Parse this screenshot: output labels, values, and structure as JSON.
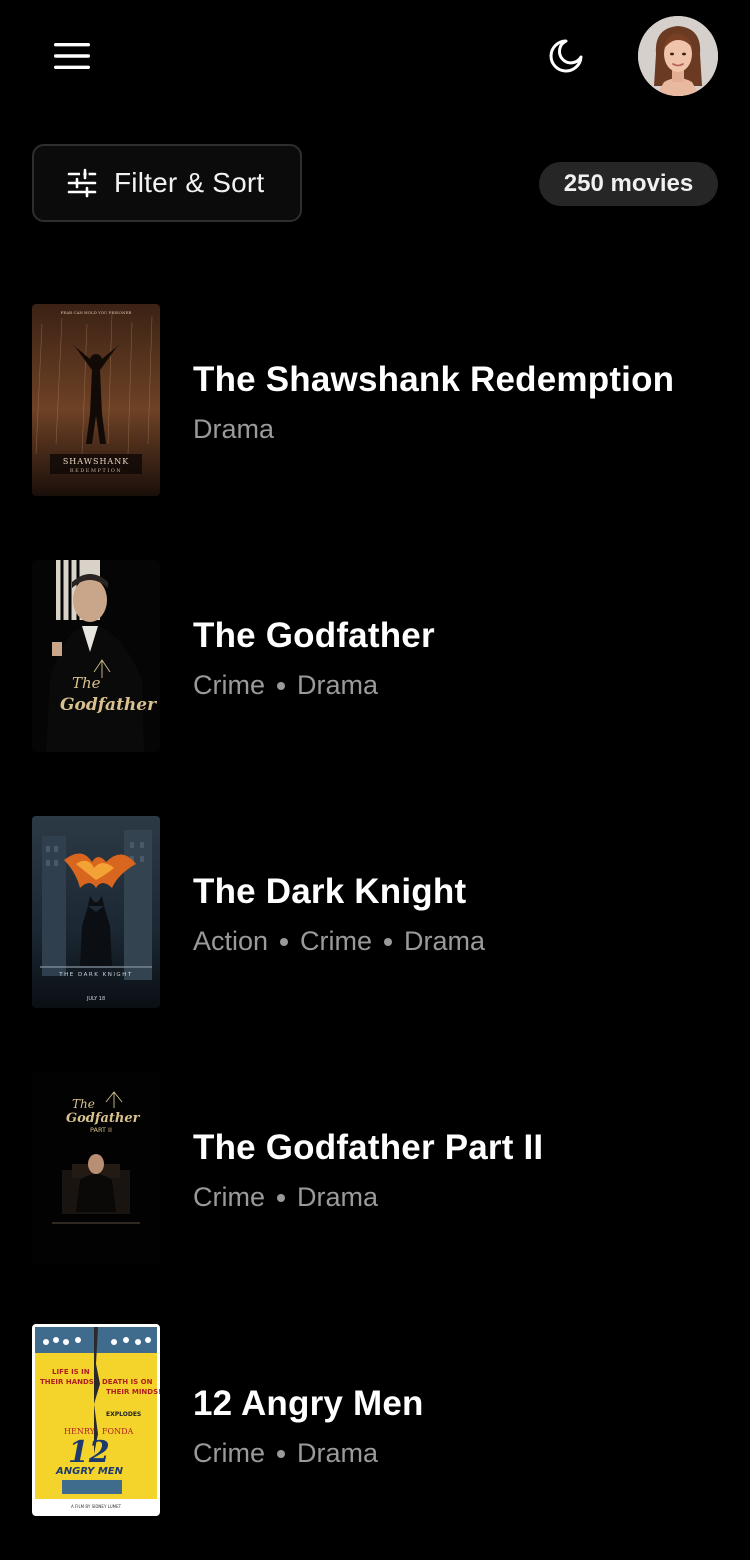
{
  "header": {
    "menu_icon": "hamburger-menu-icon",
    "theme_icon": "moon-icon",
    "avatar_icon": "user-avatar"
  },
  "toolbar": {
    "filter_label": "Filter & Sort",
    "filter_icon": "sliders-icon",
    "count_label": "250 movies"
  },
  "movies": [
    {
      "title": "The Shawshank Redemption",
      "genres": [
        "Drama"
      ],
      "poster_text": "SHAWSHANK"
    },
    {
      "title": "The Godfather",
      "genres": [
        "Crime",
        "Drama"
      ],
      "poster_text": "The Godfather"
    },
    {
      "title": "The Dark Knight",
      "genres": [
        "Action",
        "Crime",
        "Drama"
      ],
      "poster_text": "THE DARK KNIGHT"
    },
    {
      "title": "The Godfather Part II",
      "genres": [
        "Crime",
        "Drama"
      ],
      "poster_text": "The Godfather PART II"
    },
    {
      "title": "12 Angry Men",
      "genres": [
        "Crime",
        "Drama"
      ],
      "poster_text": "12 ANGRY MEN"
    }
  ],
  "colors": {
    "background": "#000000",
    "title": "#ffffff",
    "genre": "#9a9a9a",
    "badge_bg": "#262626",
    "button_border": "#2e2e2e"
  }
}
